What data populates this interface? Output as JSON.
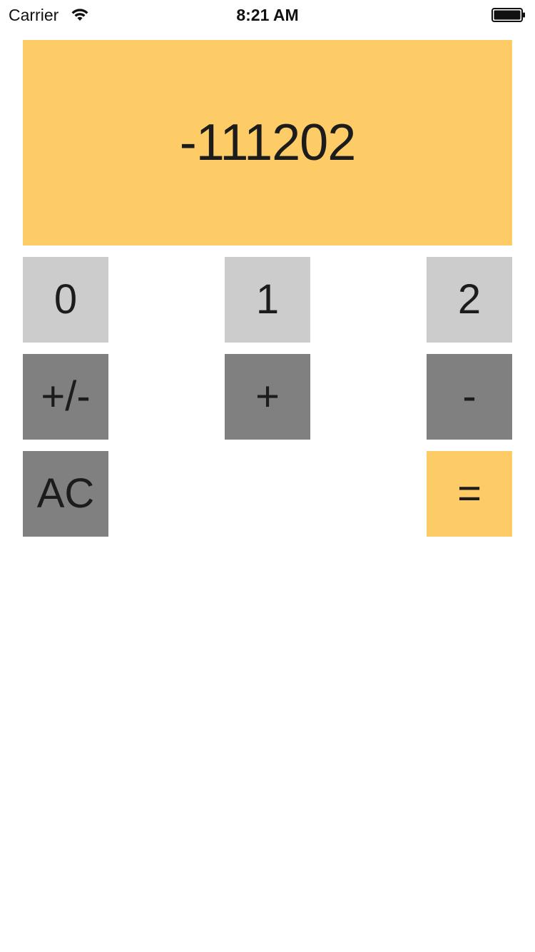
{
  "status_bar": {
    "carrier": "Carrier",
    "time": "8:21 AM",
    "wifi_icon": "wifi-icon",
    "battery_icon": "battery-icon",
    "battery_level": 1.0
  },
  "display": {
    "value": "-111202",
    "background": "#fecc66"
  },
  "keys": {
    "zero": "0",
    "one": "1",
    "two": "2",
    "sign": "+/-",
    "plus": "+",
    "minus": "-",
    "clear": "AC",
    "equals": "="
  },
  "colors": {
    "digit_key": "#cccccc",
    "operator_key": "#808080",
    "accent": "#fecc66",
    "text": "#1c1c1c"
  }
}
